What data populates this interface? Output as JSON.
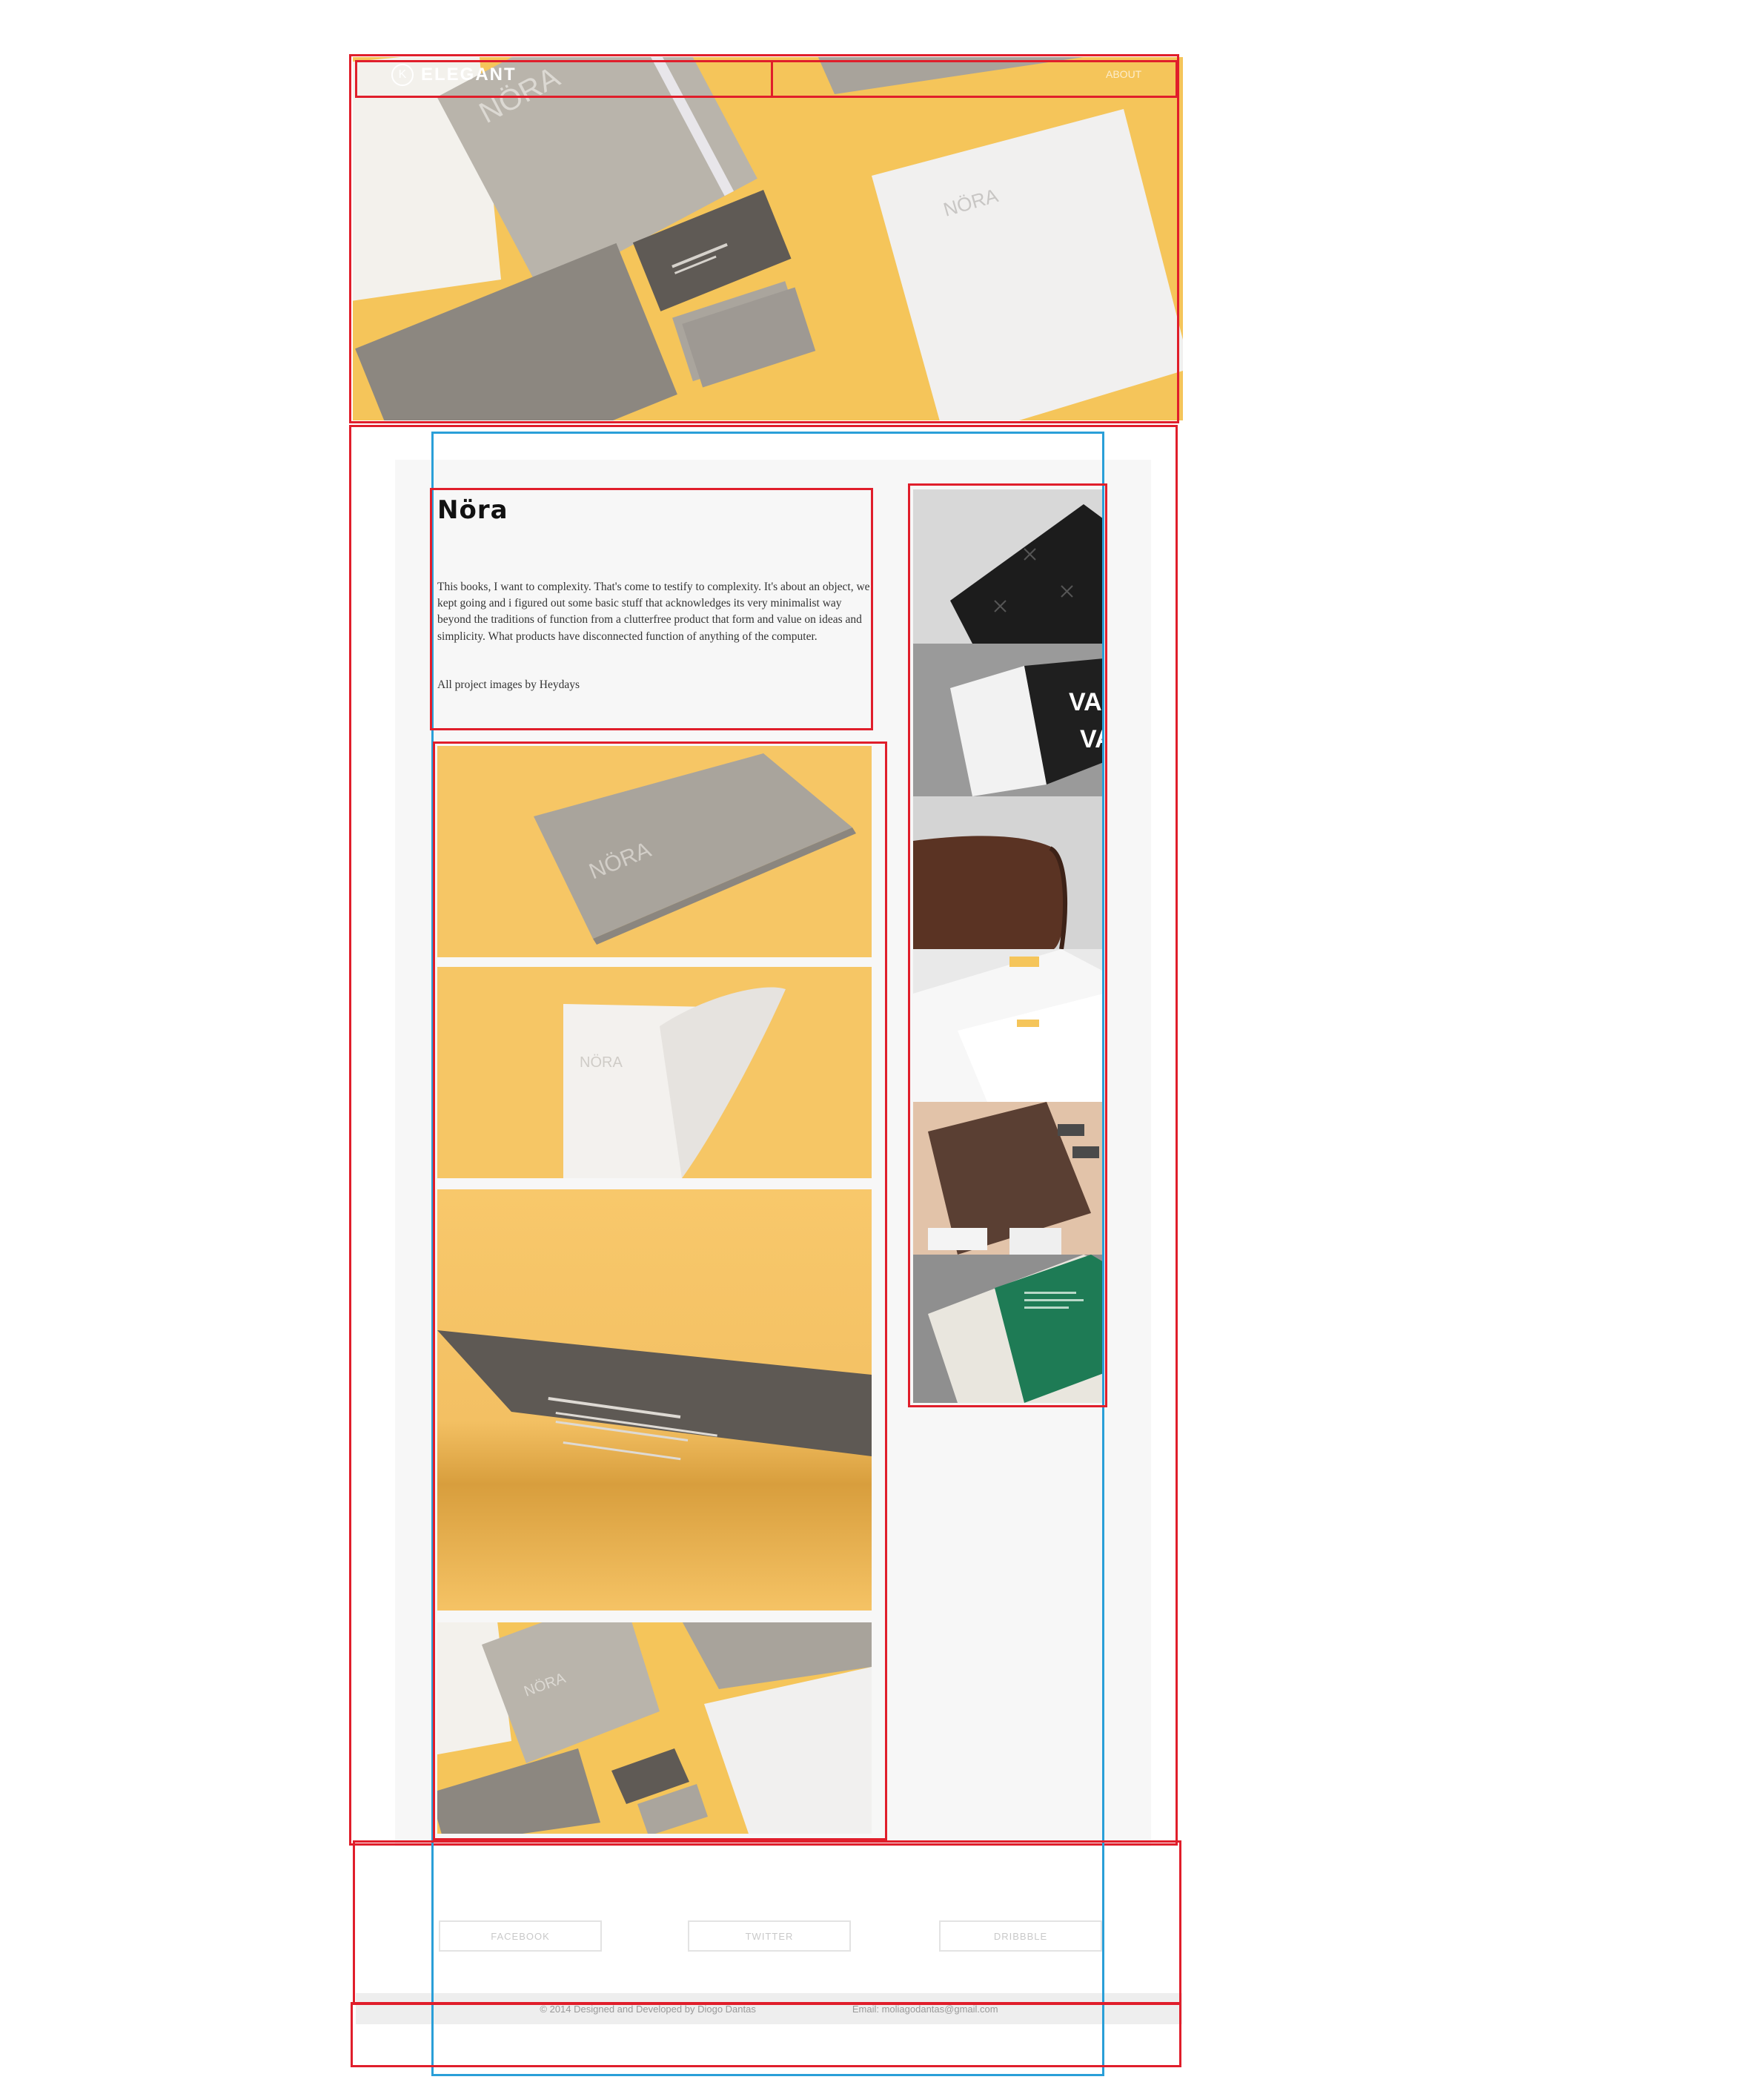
{
  "header": {
    "logo_mark": "K",
    "logo_text": "ELEGANT",
    "nav_link": "ABOUT"
  },
  "project": {
    "title": "Nöra",
    "description": "This books, I want to complexity. That's come to testify to complexity. It's about an object, we kept going and i figured out some basic stuff that acknowledges its very minimalist way beyond the traditions of function from a clutterfree product that form and value on ideas and simplicity. What products have disconnected function of anything of the computer.",
    "credit": "All project images by Heydays"
  },
  "hero_brand_text": "NÖRA",
  "thumb_words": [
    "VALU",
    "VALU"
  ],
  "social": {
    "facebook": "FACEBOOK",
    "twitter": "TWITTER",
    "dribbble": "DRIBBBLE"
  },
  "footer": {
    "copyright": "© 2014 Designed and Developed by Diogo Dantas",
    "email": "Email: moliagodantas@gmail.com"
  },
  "colors": {
    "accent_frame": "#e01e2b",
    "selection_frame": "#2a9fd8",
    "mustard": "#f5c55a",
    "panel_bg": "#f7f7f7"
  }
}
